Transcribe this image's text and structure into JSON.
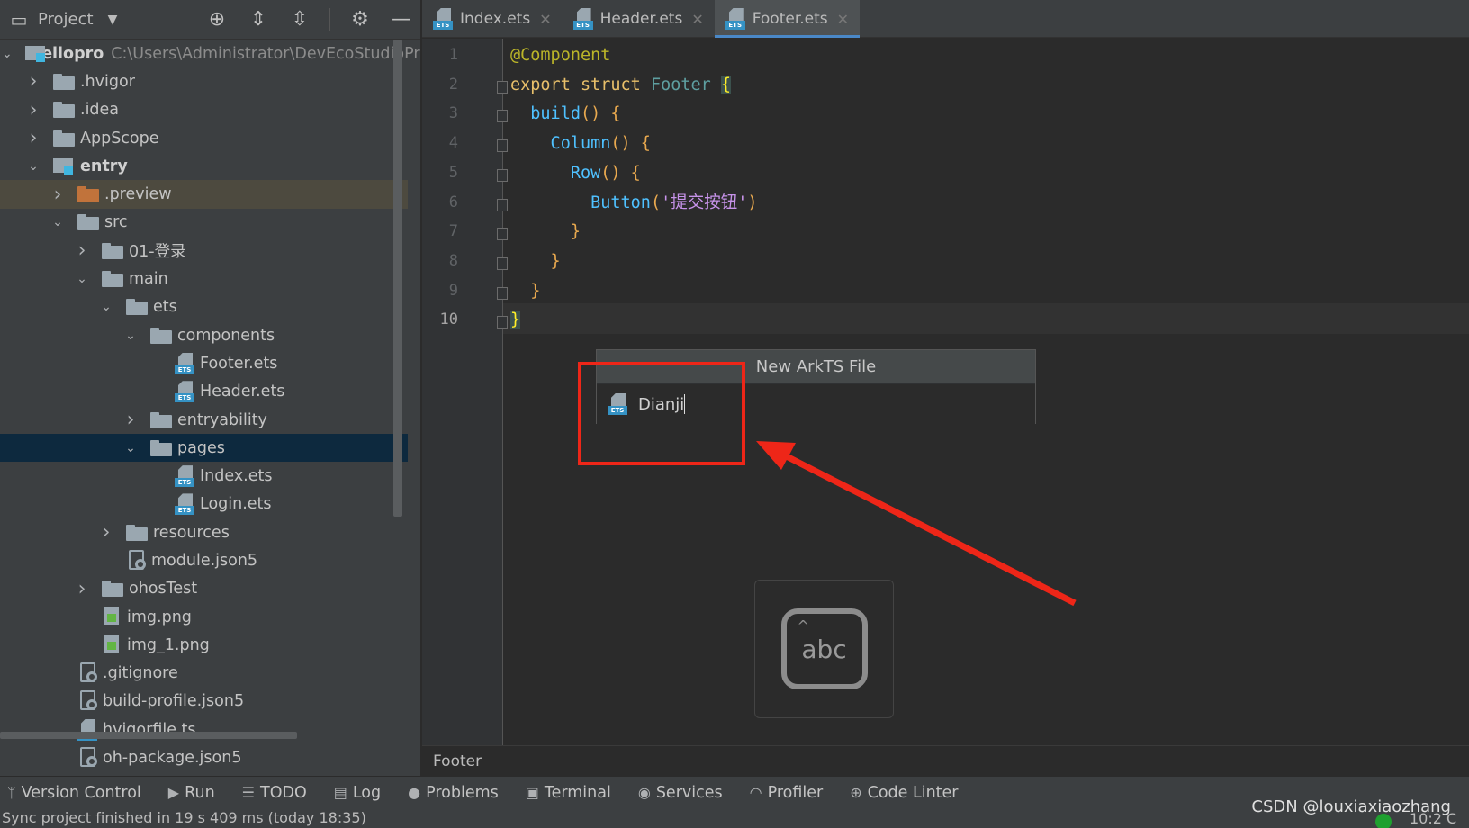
{
  "project_panel": {
    "title": "Project",
    "tree": [
      {
        "label": "hellopro",
        "path": "C:\\Users\\Administrator\\DevEcoStudioPro",
        "depth": 0,
        "arrow": "down",
        "icon": "module",
        "bold": true
      },
      {
        "label": ".hvigor",
        "depth": 1,
        "arrow": "right",
        "icon": "folder"
      },
      {
        "label": ".idea",
        "depth": 1,
        "arrow": "right",
        "icon": "folder"
      },
      {
        "label": "AppScope",
        "depth": 1,
        "arrow": "right",
        "icon": "folder"
      },
      {
        "label": "entry",
        "depth": 1,
        "arrow": "down",
        "icon": "module",
        "bold": true
      },
      {
        "label": ".preview",
        "depth": 2,
        "arrow": "right",
        "icon": "folder-orange",
        "state": "highlight"
      },
      {
        "label": "src",
        "depth": 2,
        "arrow": "down",
        "icon": "folder"
      },
      {
        "label": "01-登录",
        "depth": 3,
        "arrow": "right",
        "icon": "folder"
      },
      {
        "label": "main",
        "depth": 3,
        "arrow": "down",
        "icon": "folder"
      },
      {
        "label": "ets",
        "depth": 4,
        "arrow": "down",
        "icon": "folder"
      },
      {
        "label": "components",
        "depth": 5,
        "arrow": "down",
        "icon": "folder"
      },
      {
        "label": "Footer.ets",
        "depth": 6,
        "arrow": "none",
        "icon": "ets"
      },
      {
        "label": "Header.ets",
        "depth": 6,
        "arrow": "none",
        "icon": "ets"
      },
      {
        "label": "entryability",
        "depth": 5,
        "arrow": "right",
        "icon": "folder"
      },
      {
        "label": "pages",
        "depth": 5,
        "arrow": "down",
        "icon": "folder",
        "state": "selected"
      },
      {
        "label": "Index.ets",
        "depth": 6,
        "arrow": "none",
        "icon": "ets"
      },
      {
        "label": "Login.ets",
        "depth": 6,
        "arrow": "none",
        "icon": "ets"
      },
      {
        "label": "resources",
        "depth": 4,
        "arrow": "right",
        "icon": "folder"
      },
      {
        "label": "module.json5",
        "depth": 4,
        "arrow": "none",
        "icon": "json"
      },
      {
        "label": "ohosTest",
        "depth": 3,
        "arrow": "right",
        "icon": "folder"
      },
      {
        "label": "img.png",
        "depth": 3,
        "arrow": "none",
        "icon": "image"
      },
      {
        "label": "img_1.png",
        "depth": 3,
        "arrow": "none",
        "icon": "image"
      },
      {
        "label": ".gitignore",
        "depth": 2,
        "arrow": "none",
        "icon": "json"
      },
      {
        "label": "build-profile.json5",
        "depth": 2,
        "arrow": "none",
        "icon": "json"
      },
      {
        "label": "hvigorfile.ts",
        "depth": 2,
        "arrow": "none",
        "icon": "ts"
      },
      {
        "label": "oh-package.json5",
        "depth": 2,
        "arrow": "none",
        "icon": "json"
      }
    ]
  },
  "tabs": [
    {
      "label": "Index.ets",
      "active": false
    },
    {
      "label": "Header.ets",
      "active": false
    },
    {
      "label": "Footer.ets",
      "active": true
    }
  ],
  "editor": {
    "line_numbers": [
      "1",
      "2",
      "3",
      "4",
      "5",
      "6",
      "7",
      "8",
      "9",
      "10"
    ],
    "current_line": "10",
    "lines": [
      [
        {
          "t": "@Component",
          "c": "ann"
        }
      ],
      [
        {
          "t": "export struct ",
          "c": "kwd"
        },
        {
          "t": "Footer ",
          "c": "cls"
        },
        {
          "t": "{",
          "c": "brace-hl"
        }
      ],
      [
        {
          "t": "  build",
          "c": "fn"
        },
        {
          "t": "() {",
          "c": "br"
        }
      ],
      [
        {
          "t": "    Column",
          "c": "fn"
        },
        {
          "t": "() {",
          "c": "br"
        }
      ],
      [
        {
          "t": "      Row",
          "c": "fn"
        },
        {
          "t": "() {",
          "c": "br"
        }
      ],
      [
        {
          "t": "        Button",
          "c": "fn"
        },
        {
          "t": "(",
          "c": "br"
        },
        {
          "t": "'提交按钮'",
          "c": "strzh"
        },
        {
          "t": ")",
          "c": "br"
        }
      ],
      [
        {
          "t": "      }",
          "c": "br"
        }
      ],
      [
        {
          "t": "    }",
          "c": "br"
        }
      ],
      [
        {
          "t": "  }",
          "c": "br"
        }
      ],
      [
        {
          "t": "}",
          "c": "brace-hl"
        }
      ]
    ]
  },
  "popup": {
    "title": "New ArkTS File",
    "input_value": "Dianji"
  },
  "ime": {
    "label": "abc",
    "up": "^"
  },
  "breadcrumb": "Footer",
  "toolbar": [
    {
      "label": "Version Control",
      "icon": "branch-icon",
      "glyph": "ᛘ"
    },
    {
      "label": "Run",
      "icon": "run-icon",
      "glyph": "▶"
    },
    {
      "label": "TODO",
      "icon": "list-icon",
      "glyph": "☰"
    },
    {
      "label": "Log",
      "icon": "log-icon",
      "glyph": "▤"
    },
    {
      "label": "Problems",
      "icon": "problems-icon",
      "glyph": "●"
    },
    {
      "label": "Terminal",
      "icon": "terminal-icon",
      "glyph": "▣"
    },
    {
      "label": "Services",
      "icon": "services-icon",
      "glyph": "◉"
    },
    {
      "label": "Profiler",
      "icon": "profiler-icon",
      "glyph": "◠"
    },
    {
      "label": "Code Linter",
      "icon": "linter-icon",
      "glyph": "⊕"
    }
  ],
  "status": {
    "message": "Sync project finished in 19 s 409 ms (today 18:35)",
    "right": "10:2  C",
    "watermark": "CSDN @louxiaxiaozhang"
  },
  "colors": {
    "accent": "#4a88c7",
    "selection": "#0d293e",
    "highlight_red": "#ee2618"
  }
}
